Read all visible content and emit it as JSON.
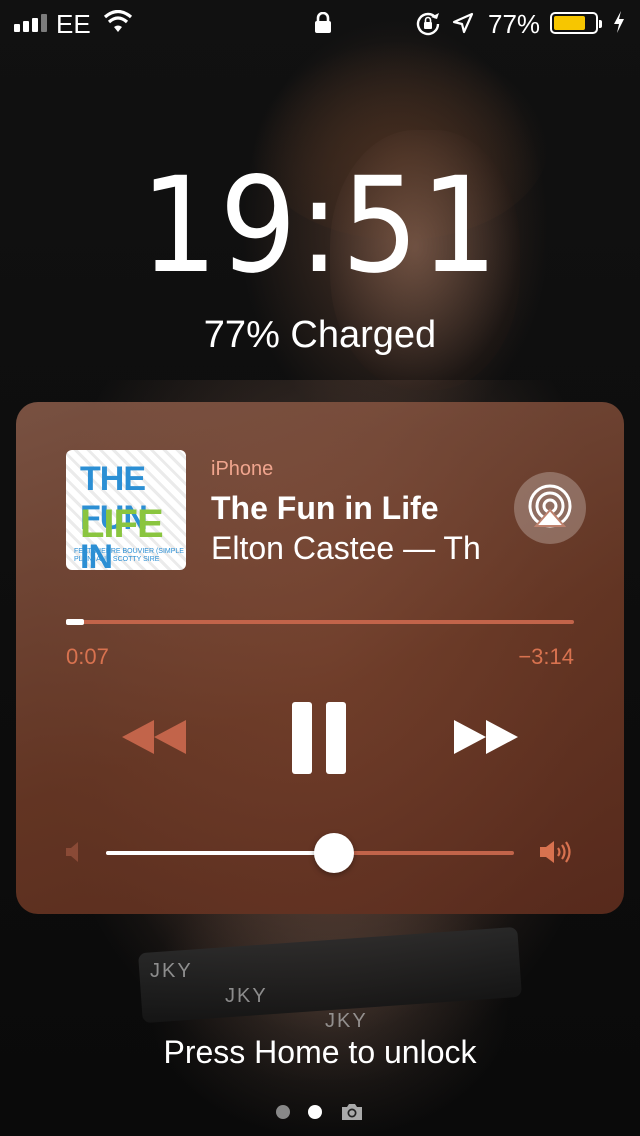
{
  "status_bar": {
    "carrier": "EE",
    "battery_percent": "77%",
    "battery_level": 0.77,
    "battery_color": "#f7c600",
    "icons": [
      "signal-icon",
      "wifi-icon",
      "lock-icon",
      "rotation-lock-icon",
      "location-icon",
      "battery-icon",
      "charging-icon"
    ]
  },
  "lock_screen": {
    "time": "19:51",
    "charge_status": "77% Charged",
    "unlock_hint": "Press Home to unlock",
    "page_count": 2,
    "active_page": 1
  },
  "now_playing": {
    "source": "iPhone",
    "title": "The Fun in Life",
    "artist": "Elton Castee — Th",
    "album_art": {
      "line1": "THE FUN IN",
      "line2": "LIFE",
      "credit": "FEAT. PIERRE BOUVIER (SIMPLE PLAN) AND SCOTTY SIRE"
    },
    "elapsed": "0:07",
    "remaining": "−3:14",
    "progress_fraction": 0.035,
    "volume_fraction": 0.56,
    "accent_color": "#c2644a",
    "controls": [
      "rewind-icon",
      "pause-icon",
      "fast-forward-icon",
      "airplay-icon"
    ]
  },
  "wallpaper_text": [
    "JKY",
    "JKY",
    "JKY"
  ]
}
